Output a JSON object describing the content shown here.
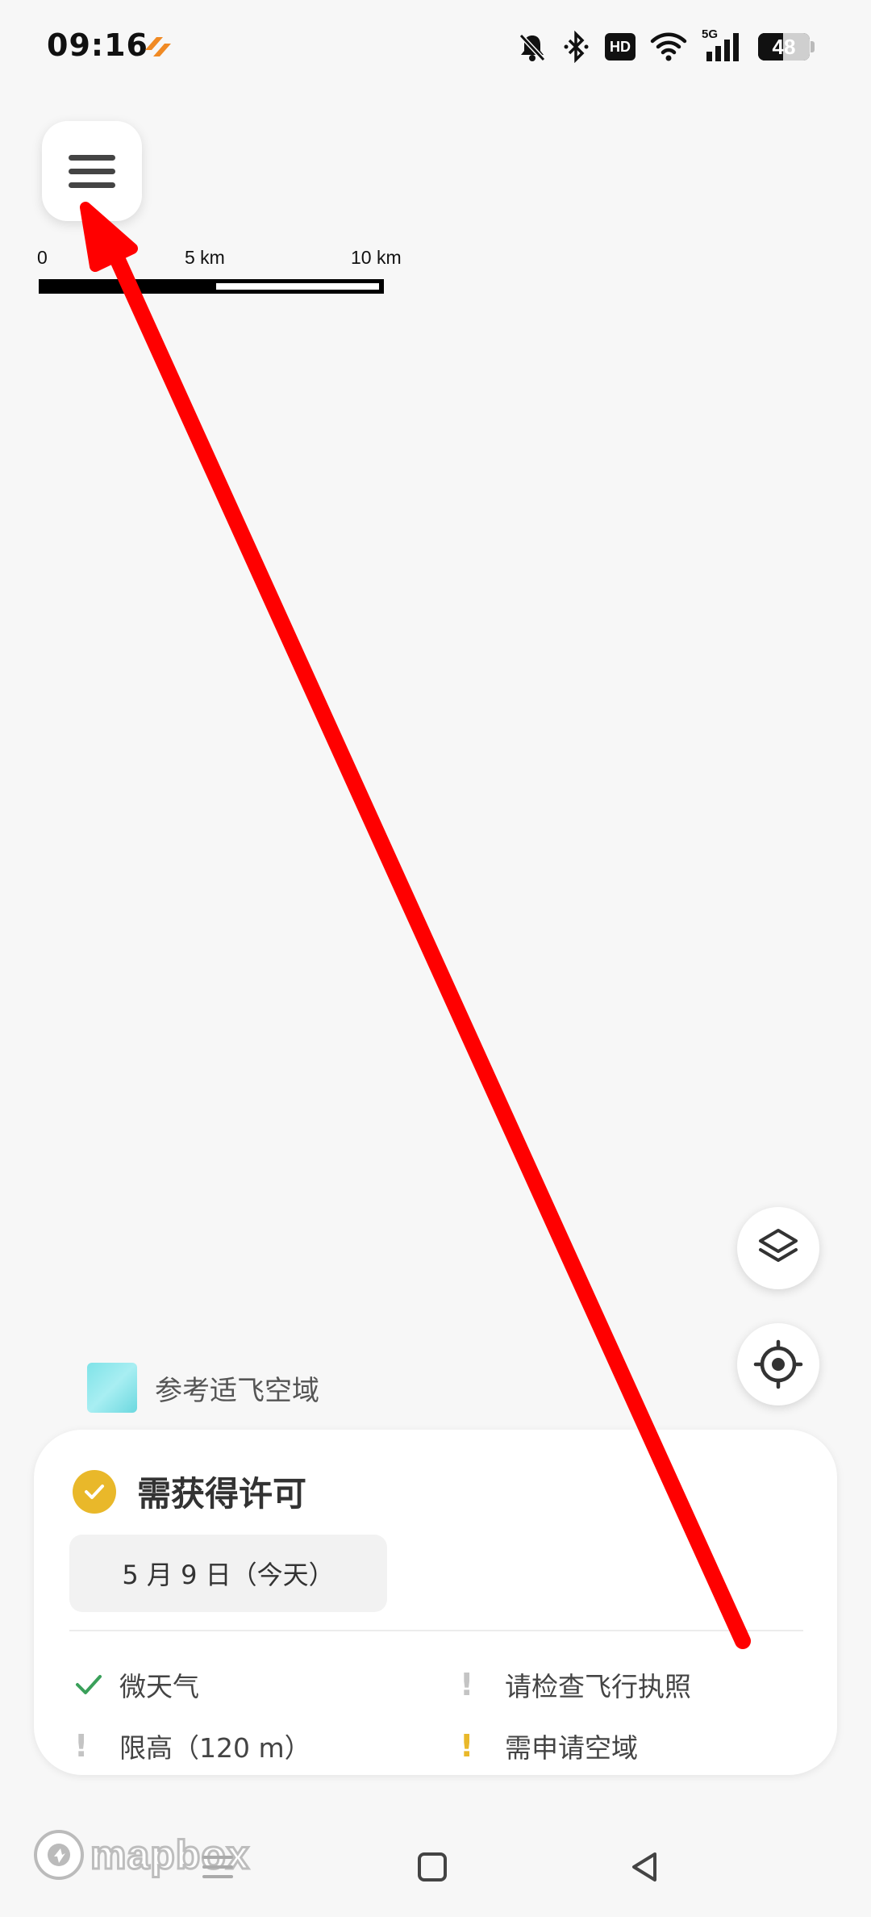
{
  "status_bar": {
    "time": "09:16",
    "hd": "HD",
    "network": "5G",
    "battery": "48",
    "battery_level": 0.48,
    "icons": [
      "app-notification-icon",
      "mute-bell-icon",
      "bluetooth-icon",
      "hd-icon",
      "wifi-icon",
      "5g-signal-icon",
      "battery-icon"
    ]
  },
  "map": {
    "scale": {
      "zero": "0",
      "mid": "5 km",
      "end": "10 km"
    },
    "legend": {
      "label": "参考适飞空域"
    }
  },
  "card": {
    "title": "需获得许可",
    "date": "5 月 9 日（今天）",
    "items": [
      {
        "label": "微天气",
        "status": "ok"
      },
      {
        "label": "请检查飞行执照",
        "status": "info"
      },
      {
        "label": "限高（120 m）",
        "status": "info"
      },
      {
        "label": "需申请空域",
        "status": "warning"
      }
    ]
  },
  "attribution": {
    "text": "mapbox"
  },
  "colors": {
    "accent_yellow": "#e9b82a",
    "ok_green": "#3aa05a",
    "arrow_red": "#ff0000"
  }
}
